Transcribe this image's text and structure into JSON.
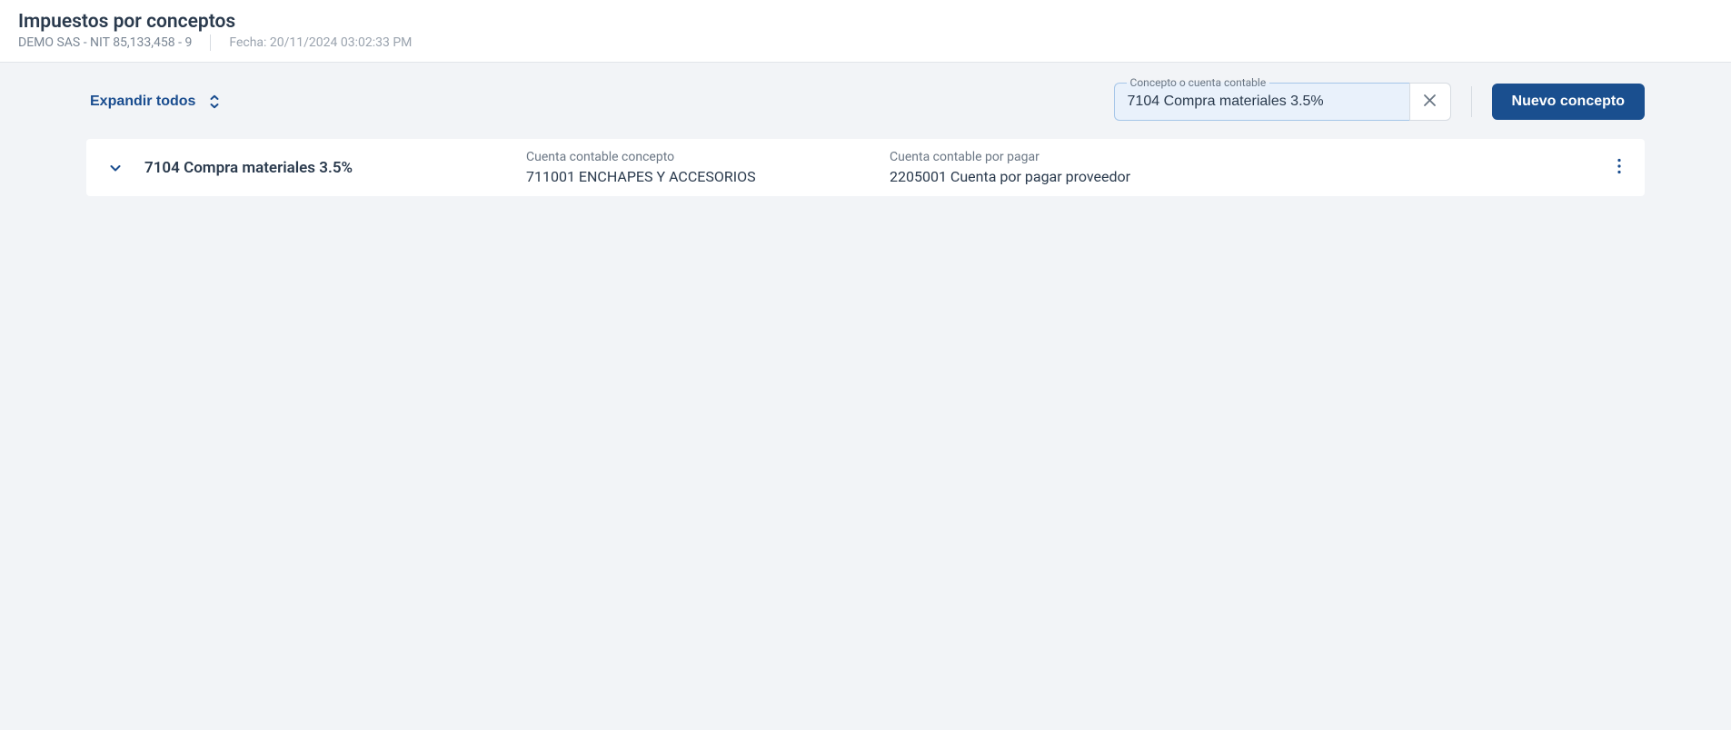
{
  "header": {
    "title": "Impuestos por conceptos",
    "company": "DEMO SAS - NIT 85,133,458 - 9",
    "date_label": "Fecha: 20/11/2024 03:02:33 PM"
  },
  "toolbar": {
    "expand_label": "Expandir todos",
    "search_label": "Concepto o cuenta contable",
    "search_value": "7104 Compra materiales 3.5%",
    "new_label": "Nuevo concepto"
  },
  "rows": [
    {
      "name": "7104 Compra materiales 3.5%",
      "col1_label": "Cuenta contable concepto",
      "col1_value": "711001 ENCHAPES Y ACCESORIOS",
      "col2_label": "Cuenta contable por pagar",
      "col2_value": "2205001 Cuenta por pagar proveedor"
    }
  ]
}
